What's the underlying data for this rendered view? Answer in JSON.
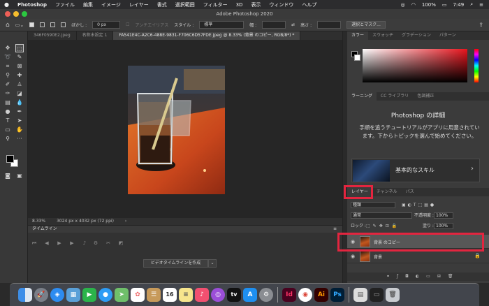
{
  "menubar": {
    "apple": "",
    "app": "Photoshop",
    "items": [
      "ファイル",
      "編集",
      "イメージ",
      "レイヤー",
      "書式",
      "選択範囲",
      "フィルター",
      "3D",
      "表示",
      "ウィンドウ",
      "ヘルプ"
    ],
    "battery": "100%",
    "time": "7:49"
  },
  "window": {
    "title": "Adobe Photoshop 2020"
  },
  "options": {
    "feather_label": "ぼかし :",
    "feather_value": "0 px",
    "antialias_label": "アンチエイリアス",
    "style_label": "スタイル :",
    "style_value": "標準",
    "width_label": "幅 :",
    "height_label": "高さ :",
    "select_mask_button": "選択とマスク..."
  },
  "tabs": [
    {
      "label": "346F0590E2.jpeg"
    },
    {
      "label": "名称未設定 1"
    },
    {
      "label": "FA541E4C-A2C6-488E-9831-F706C6D57FDE.jpeg @ 8.33% (背景 のコピー, RGB/8*) *"
    }
  ],
  "status": {
    "zoom": "8.33%",
    "dimensions": "3024 px x 4032 px (72 ppi)"
  },
  "timeline": {
    "title": "タイムライン",
    "create_button": "ビデオタイムラインを作成",
    "dropdown": "⌄"
  },
  "color_panel": {
    "tabs": [
      "カラー",
      "スウォッチ",
      "グラデーション",
      "パターン"
    ],
    "hue_color": "#e8141d"
  },
  "learn_panel": {
    "tabs": [
      "ラーニング",
      "CC ライブラリ",
      "色調補正"
    ],
    "title": "Photoshop の詳細",
    "text": "手順を追うチュートリアルがアプリに用意されています。下からトピックを選んで始めてください。",
    "card_label": "基本的なスキル"
  },
  "layers_panel": {
    "tabs": [
      "レイヤー",
      "チャンネル",
      "パス"
    ],
    "filter_kind": "種類",
    "blend_mode": "通常",
    "opacity_label": "不透明度 :",
    "opacity_value": "100%",
    "lock_label": "ロック :",
    "fill_label": "塗り :",
    "fill_value": "100%",
    "layers": [
      {
        "name": "背景 のコピー",
        "selected": true
      },
      {
        "name": "背景",
        "locked": true
      }
    ]
  },
  "dock": {
    "apps": [
      "Finder",
      "Launchpad",
      "Safari",
      "Preview",
      "FaceTime",
      "Messages",
      "Maps",
      "Photos",
      "Contacts",
      "Calendar",
      "Notes",
      "Music",
      "Podcasts",
      "TV",
      "App Store",
      "System Preferences",
      "InDesign",
      "Chrome",
      "Illustrator",
      "Photoshop",
      "Document",
      "Screenshot",
      "Trash"
    ],
    "calendar_day": "16",
    "id_label": "Id",
    "ai_label": "Ai",
    "ps_label": "Ps",
    "tv_label": "tv"
  },
  "highlight_color": "#e3253f"
}
